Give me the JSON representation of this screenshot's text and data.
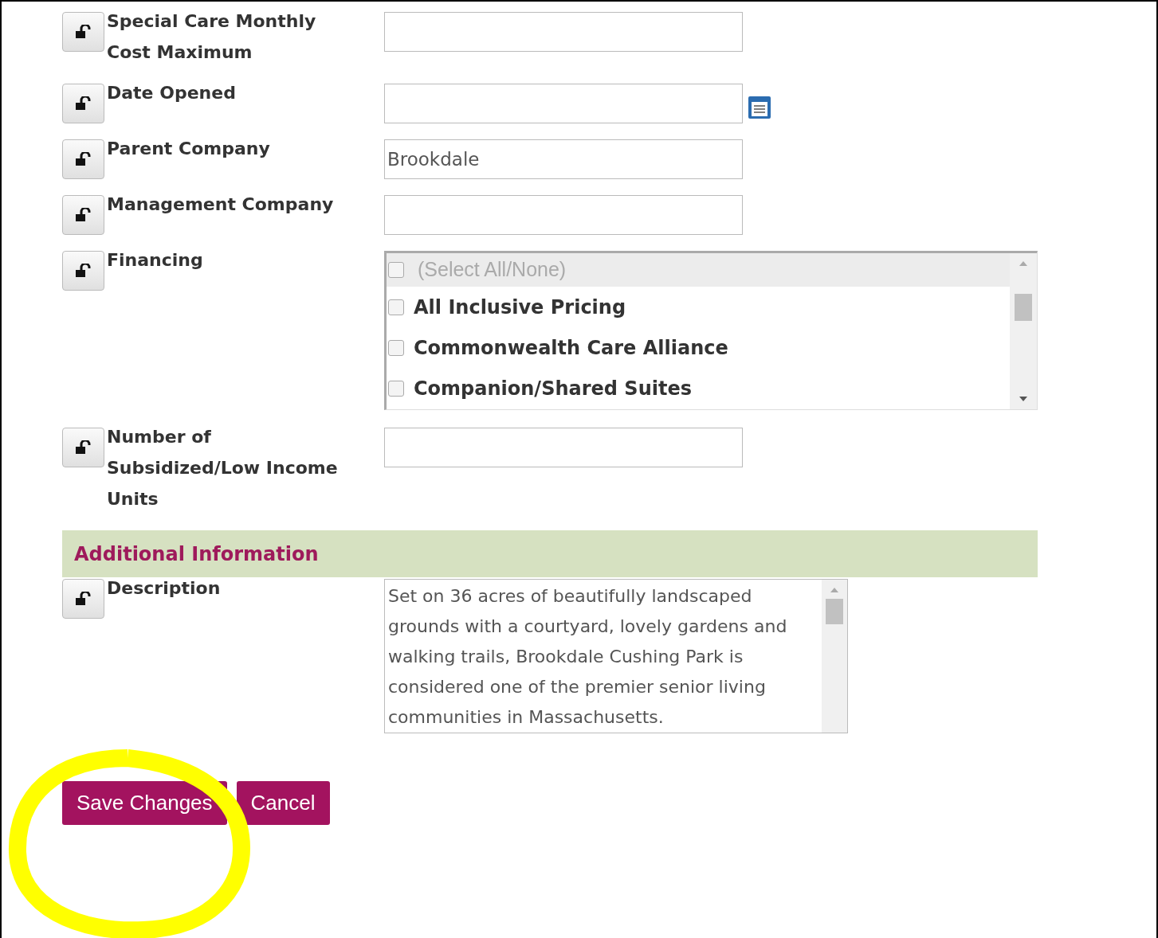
{
  "fields": [
    {
      "kind": "text",
      "label": "Special Care Monthly Cost Maximum"
    },
    {
      "kind": "date",
      "label": "Date Opened"
    },
    {
      "kind": "text",
      "label": "Parent Company",
      "value": "Brookdale"
    },
    {
      "kind": "text",
      "label": "Management Company"
    },
    {
      "kind": "multiselect",
      "label": "Financing",
      "options": [
        {
          "kind": "select_all",
          "label": "(Select All/None)",
          "checked": false
        },
        {
          "kind": "option",
          "label": "All Inclusive Pricing",
          "checked": false
        },
        {
          "kind": "option",
          "label": "Commonwealth Care Alliance",
          "checked": false
        },
        {
          "kind": "option",
          "label": "Companion/Shared Suites",
          "checked": false
        }
      ]
    },
    {
      "kind": "text",
      "label": "Number of Subsidized/Low Income Units"
    },
    {
      "kind": "section",
      "label": "Additional Information"
    },
    {
      "kind": "textarea",
      "label": "Description",
      "value": "Set on 36 acres of beautifully landscaped grounds with a courtyard, lovely gardens and walking trails, Brookdale Cushing Park is considered one of the premier senior living communities in Massachusetts."
    }
  ],
  "buttons": [
    "Save Changes",
    "Cancel"
  ]
}
